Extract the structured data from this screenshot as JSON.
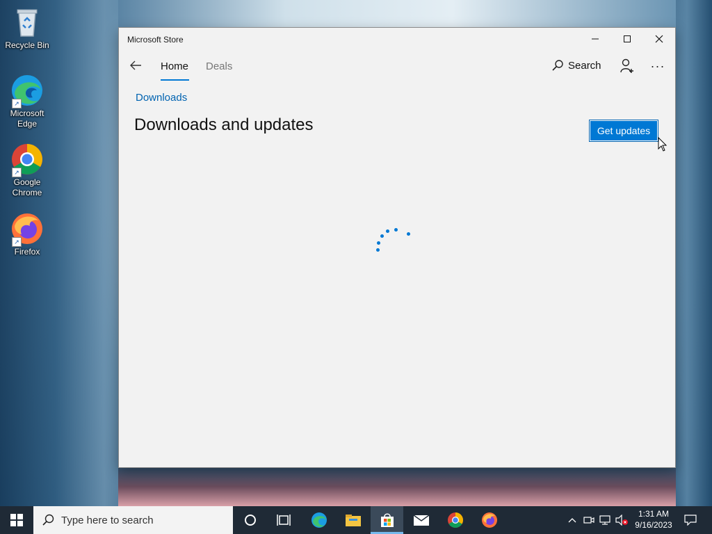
{
  "desktop": {
    "icons": [
      {
        "label": "Recycle Bin",
        "icon": "recycle-bin-icon"
      },
      {
        "label": "Microsoft Edge",
        "icon": "edge-icon"
      },
      {
        "label": "Google Chrome",
        "icon": "chrome-icon"
      },
      {
        "label": "Firefox",
        "icon": "firefox-icon"
      }
    ]
  },
  "window": {
    "title": "Microsoft Store",
    "controls": {
      "minimize": "minimize-icon",
      "maximize": "maximize-icon",
      "close": "close-icon"
    }
  },
  "nav": {
    "back_icon": "back-arrow-icon",
    "tabs": [
      {
        "label": "Home",
        "active": true
      },
      {
        "label": "Deals",
        "active": false
      }
    ],
    "search_label": "Search",
    "user_icon": "add-user-icon",
    "more_label": "···"
  },
  "page": {
    "breadcrumb": "Downloads",
    "heading": "Downloads and updates",
    "get_updates_label": "Get updates",
    "loading": true
  },
  "taskbar": {
    "search_placeholder": "Type here to search",
    "apps": [
      "cortana-icon",
      "task-view-icon",
      "edge-icon",
      "file-explorer-icon",
      "store-icon",
      "mail-icon",
      "chrome-icon",
      "firefox-icon"
    ],
    "active_app": "store-icon",
    "time": "1:31 AM",
    "date": "9/16/2023"
  },
  "colors": {
    "accent": "#0078d4",
    "link": "#0063b1",
    "taskbar": "#1f2a36",
    "window_bg": "#f2f2f2"
  }
}
